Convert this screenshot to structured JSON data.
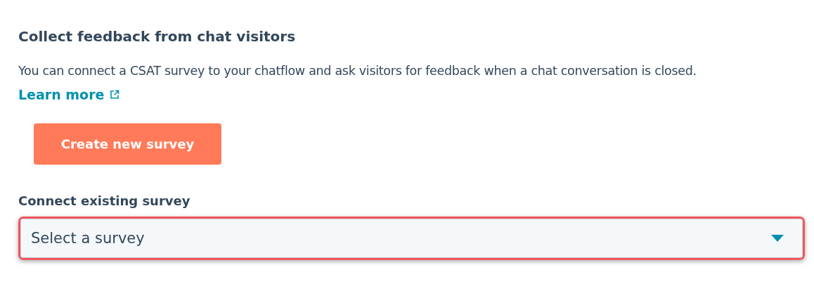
{
  "heading": "Collect feedback from chat visitors",
  "description": "You can connect a CSAT survey to your chatflow and ask visitors for feedback when a chat conversation is closed.",
  "learn_more": {
    "label": "Learn more"
  },
  "create_button": {
    "label": "Create new survey"
  },
  "connect": {
    "label": "Connect existing survey",
    "placeholder": "Select a survey",
    "highlighted": true
  }
}
